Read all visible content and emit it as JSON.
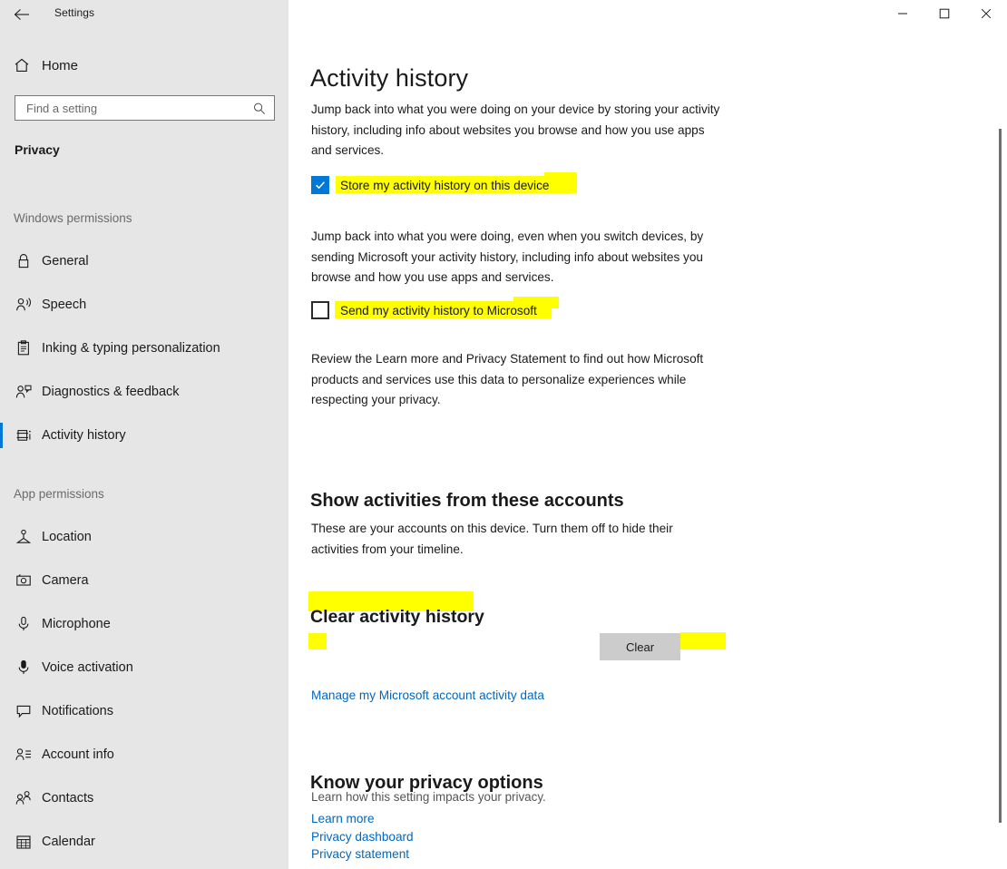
{
  "window": {
    "app_title": "Settings",
    "back_icon": "back-arrow-icon",
    "controls": {
      "minimize": "minimize-icon",
      "maximize": "maximize-icon",
      "close": "close-icon"
    }
  },
  "sidebar": {
    "home_label": "Home",
    "home_icon": "home-icon",
    "search": {
      "placeholder": "Find a setting",
      "value": "",
      "icon": "search-icon"
    },
    "category": "Privacy",
    "groups": [
      {
        "title": "Windows permissions",
        "items": [
          {
            "label": "General",
            "icon": "lock-icon",
            "selected": false
          },
          {
            "label": "Speech",
            "icon": "speech-person-icon",
            "selected": false
          },
          {
            "label": "Inking & typing personalization",
            "icon": "clipboard-pen-icon",
            "selected": false
          },
          {
            "label": "Diagnostics & feedback",
            "icon": "person-feedback-icon",
            "selected": false
          },
          {
            "label": "Activity history",
            "icon": "activity-history-icon",
            "selected": true
          }
        ]
      },
      {
        "title": "App permissions",
        "items": [
          {
            "label": "Location",
            "icon": "location-pin-icon",
            "selected": false
          },
          {
            "label": "Camera",
            "icon": "camera-icon",
            "selected": false
          },
          {
            "label": "Microphone",
            "icon": "microphone-icon",
            "selected": false
          },
          {
            "label": "Voice activation",
            "icon": "voice-activation-icon",
            "selected": false
          },
          {
            "label": "Notifications",
            "icon": "notification-bubble-icon",
            "selected": false
          },
          {
            "label": "Account info",
            "icon": "account-info-icon",
            "selected": false
          },
          {
            "label": "Contacts",
            "icon": "contacts-icon",
            "selected": false
          },
          {
            "label": "Calendar",
            "icon": "calendar-icon",
            "selected": false
          }
        ]
      }
    ]
  },
  "main": {
    "page_title": "Activity history",
    "paragraph_1": "Jump back into what you were doing on your device by storing your activity history, including info about websites you browse and how you use apps and services.",
    "checkbox_store": {
      "label": "Store my activity history on this device",
      "checked": true,
      "highlighted": true
    },
    "paragraph_2": "Jump back into what you were doing, even when you switch devices, by sending Microsoft your activity history, including info about websites you browse and how you use apps and services.",
    "checkbox_send": {
      "label": "Send my activity history to Microsoft",
      "checked": false,
      "highlighted": true
    },
    "paragraph_3": "Review the Learn more and Privacy Statement to find out how Microsoft products and services use this data to personalize experiences while respecting your privacy.",
    "accounts_heading": "Show activities from these accounts",
    "accounts_description": "These are your accounts on this device. Turn them off to hide their activities from your timeline.",
    "clear_heading": "Clear activity history",
    "clear_button_label": "Clear",
    "manage_link": "Manage my Microsoft account activity data",
    "privacy_options": {
      "heading": "Know your privacy options",
      "description": "Learn how this setting impacts your privacy.",
      "links": [
        "Learn more",
        "Privacy dashboard",
        "Privacy statement"
      ]
    }
  },
  "colors": {
    "accent": "#0078D7",
    "highlight": "#FFFF00",
    "link": "#0067C0",
    "sidebar_bg": "#E6E6E6",
    "button_bg": "#CCCCCC"
  }
}
